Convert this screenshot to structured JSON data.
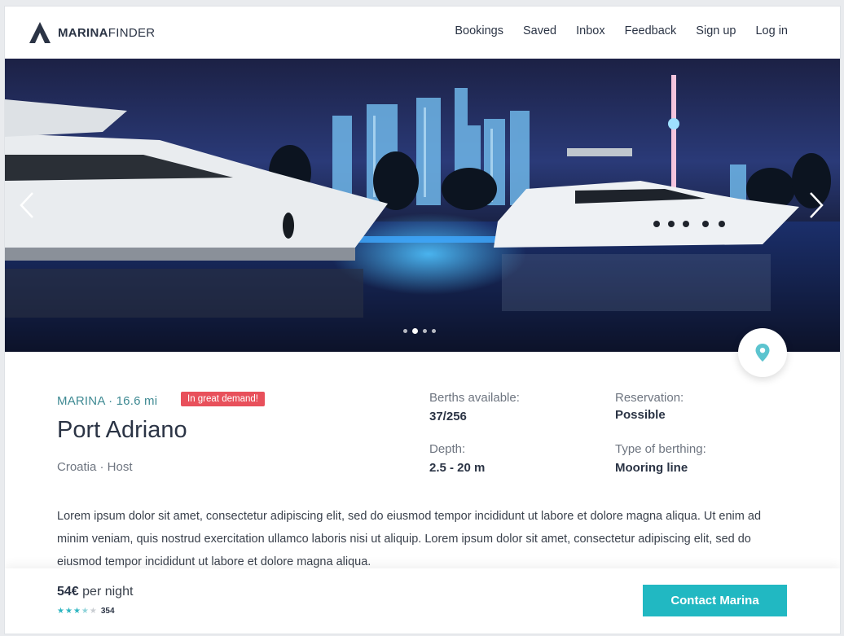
{
  "brand": {
    "bold": "MARINA",
    "light": "FINDER"
  },
  "nav": [
    {
      "label": "Bookings"
    },
    {
      "label": "Saved"
    },
    {
      "label": "Inbox"
    },
    {
      "label": "Feedback"
    },
    {
      "label": "Sign up"
    },
    {
      "label": "Log in"
    }
  ],
  "gallery": {
    "image": "night harbor with two white yachts and illuminated city skyline",
    "slide_count": 4,
    "active_slide": 2,
    "prev_icon": "chevron-left-icon",
    "next_icon": "chevron-right-icon"
  },
  "listing": {
    "kicker": "MARINA · 16.6 mi",
    "badge": "In great demand!",
    "title": "Port Adriano",
    "subtitle": "Croatia · Host",
    "facts": {
      "berths": {
        "label": "Berths available:",
        "value": "37/256"
      },
      "reservation": {
        "label": "Reservation:",
        "value": "Possible"
      },
      "depth": {
        "label": "Depth:",
        "value": "2.5 - 20 m"
      },
      "berthing": {
        "label": "Type of berthing:",
        "value": "Mooring line"
      }
    },
    "description": "Lorem ipsum dolor sit amet, consectetur adipiscing elit, sed do eiusmod tempor incididunt ut labore et dolore magna aliqua. Ut enim ad minim veniam, quis nostrud exercitation ullamco laboris nisi ut aliquip. Lorem ipsum dolor sit amet, consectetur adipiscing elit, sed do eiusmod tempor incididunt ut labore et dolore magna aliqua."
  },
  "footer": {
    "price": "54€",
    "unit": "per night",
    "rating": 3.5,
    "review_count": "354",
    "cta": "Contact Marina"
  },
  "colors": {
    "accent": "#21b8c2",
    "badge": "#e8505b",
    "kicker": "#3f8a93",
    "text": "#2b3445"
  }
}
